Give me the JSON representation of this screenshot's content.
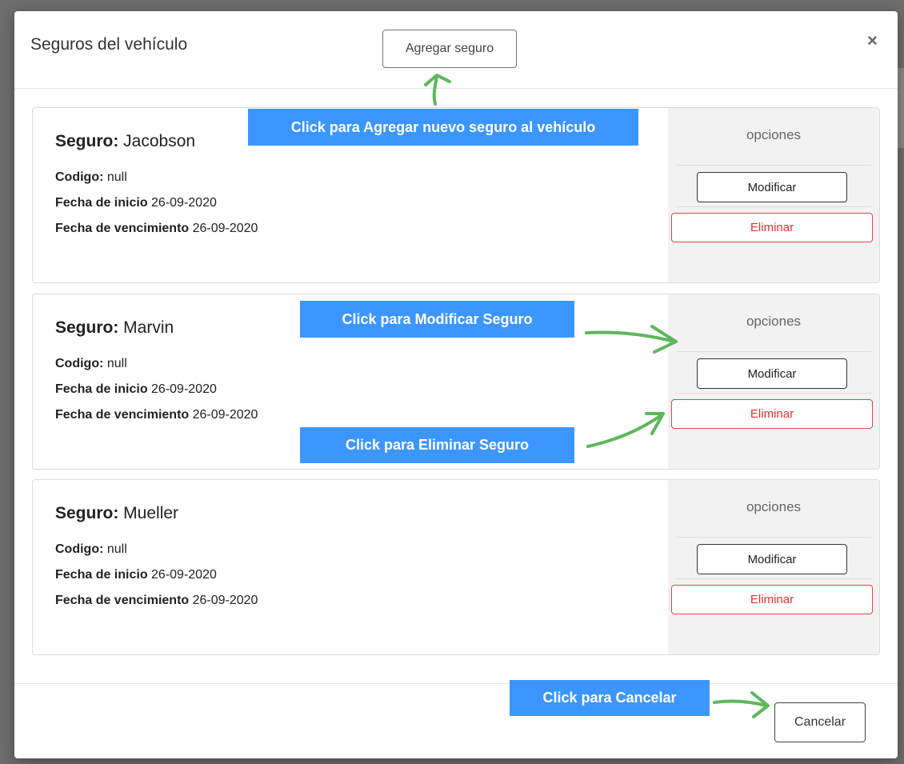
{
  "modal": {
    "title": "Seguros del vehículo",
    "add_button": "Agregar seguro",
    "close_glyph": "×",
    "cancel_button": "Cancelar"
  },
  "insurances": [
    {
      "label": "Seguro:",
      "name": "Jacobson",
      "code_label": "Codigo:",
      "code": "null",
      "start_label": "Fecha de inicio",
      "start": "26-09-2020",
      "end_label": "Fecha de vencimiento",
      "end": "26-09-2020",
      "options_label": "opciones",
      "modify": "Modificar",
      "delete": "Eliminar"
    },
    {
      "label": "Seguro:",
      "name": "Marvin",
      "code_label": "Codigo:",
      "code": "null",
      "start_label": "Fecha de inicio",
      "start": "26-09-2020",
      "end_label": "Fecha de vencimiento",
      "end": "26-09-2020",
      "options_label": "opciones",
      "modify": "Modificar",
      "delete": "Eliminar"
    },
    {
      "label": "Seguro:",
      "name": "Mueller",
      "code_label": "Codigo:",
      "code": "null",
      "start_label": "Fecha de inicio",
      "start": "26-09-2020",
      "end_label": "Fecha de vencimiento",
      "end": "26-09-2020",
      "options_label": "opciones",
      "modify": "Modificar",
      "delete": "Eliminar"
    }
  ],
  "callouts": {
    "add": "Click para Agregar nuevo seguro al vehículo",
    "modify": "Click para Modificar Seguro",
    "delete": "Click para Eliminar Seguro",
    "cancel": "Click para Cancelar"
  },
  "colors": {
    "callout": "#3d96ff",
    "arrow": "#5cb85c",
    "delete": "#e03333"
  }
}
